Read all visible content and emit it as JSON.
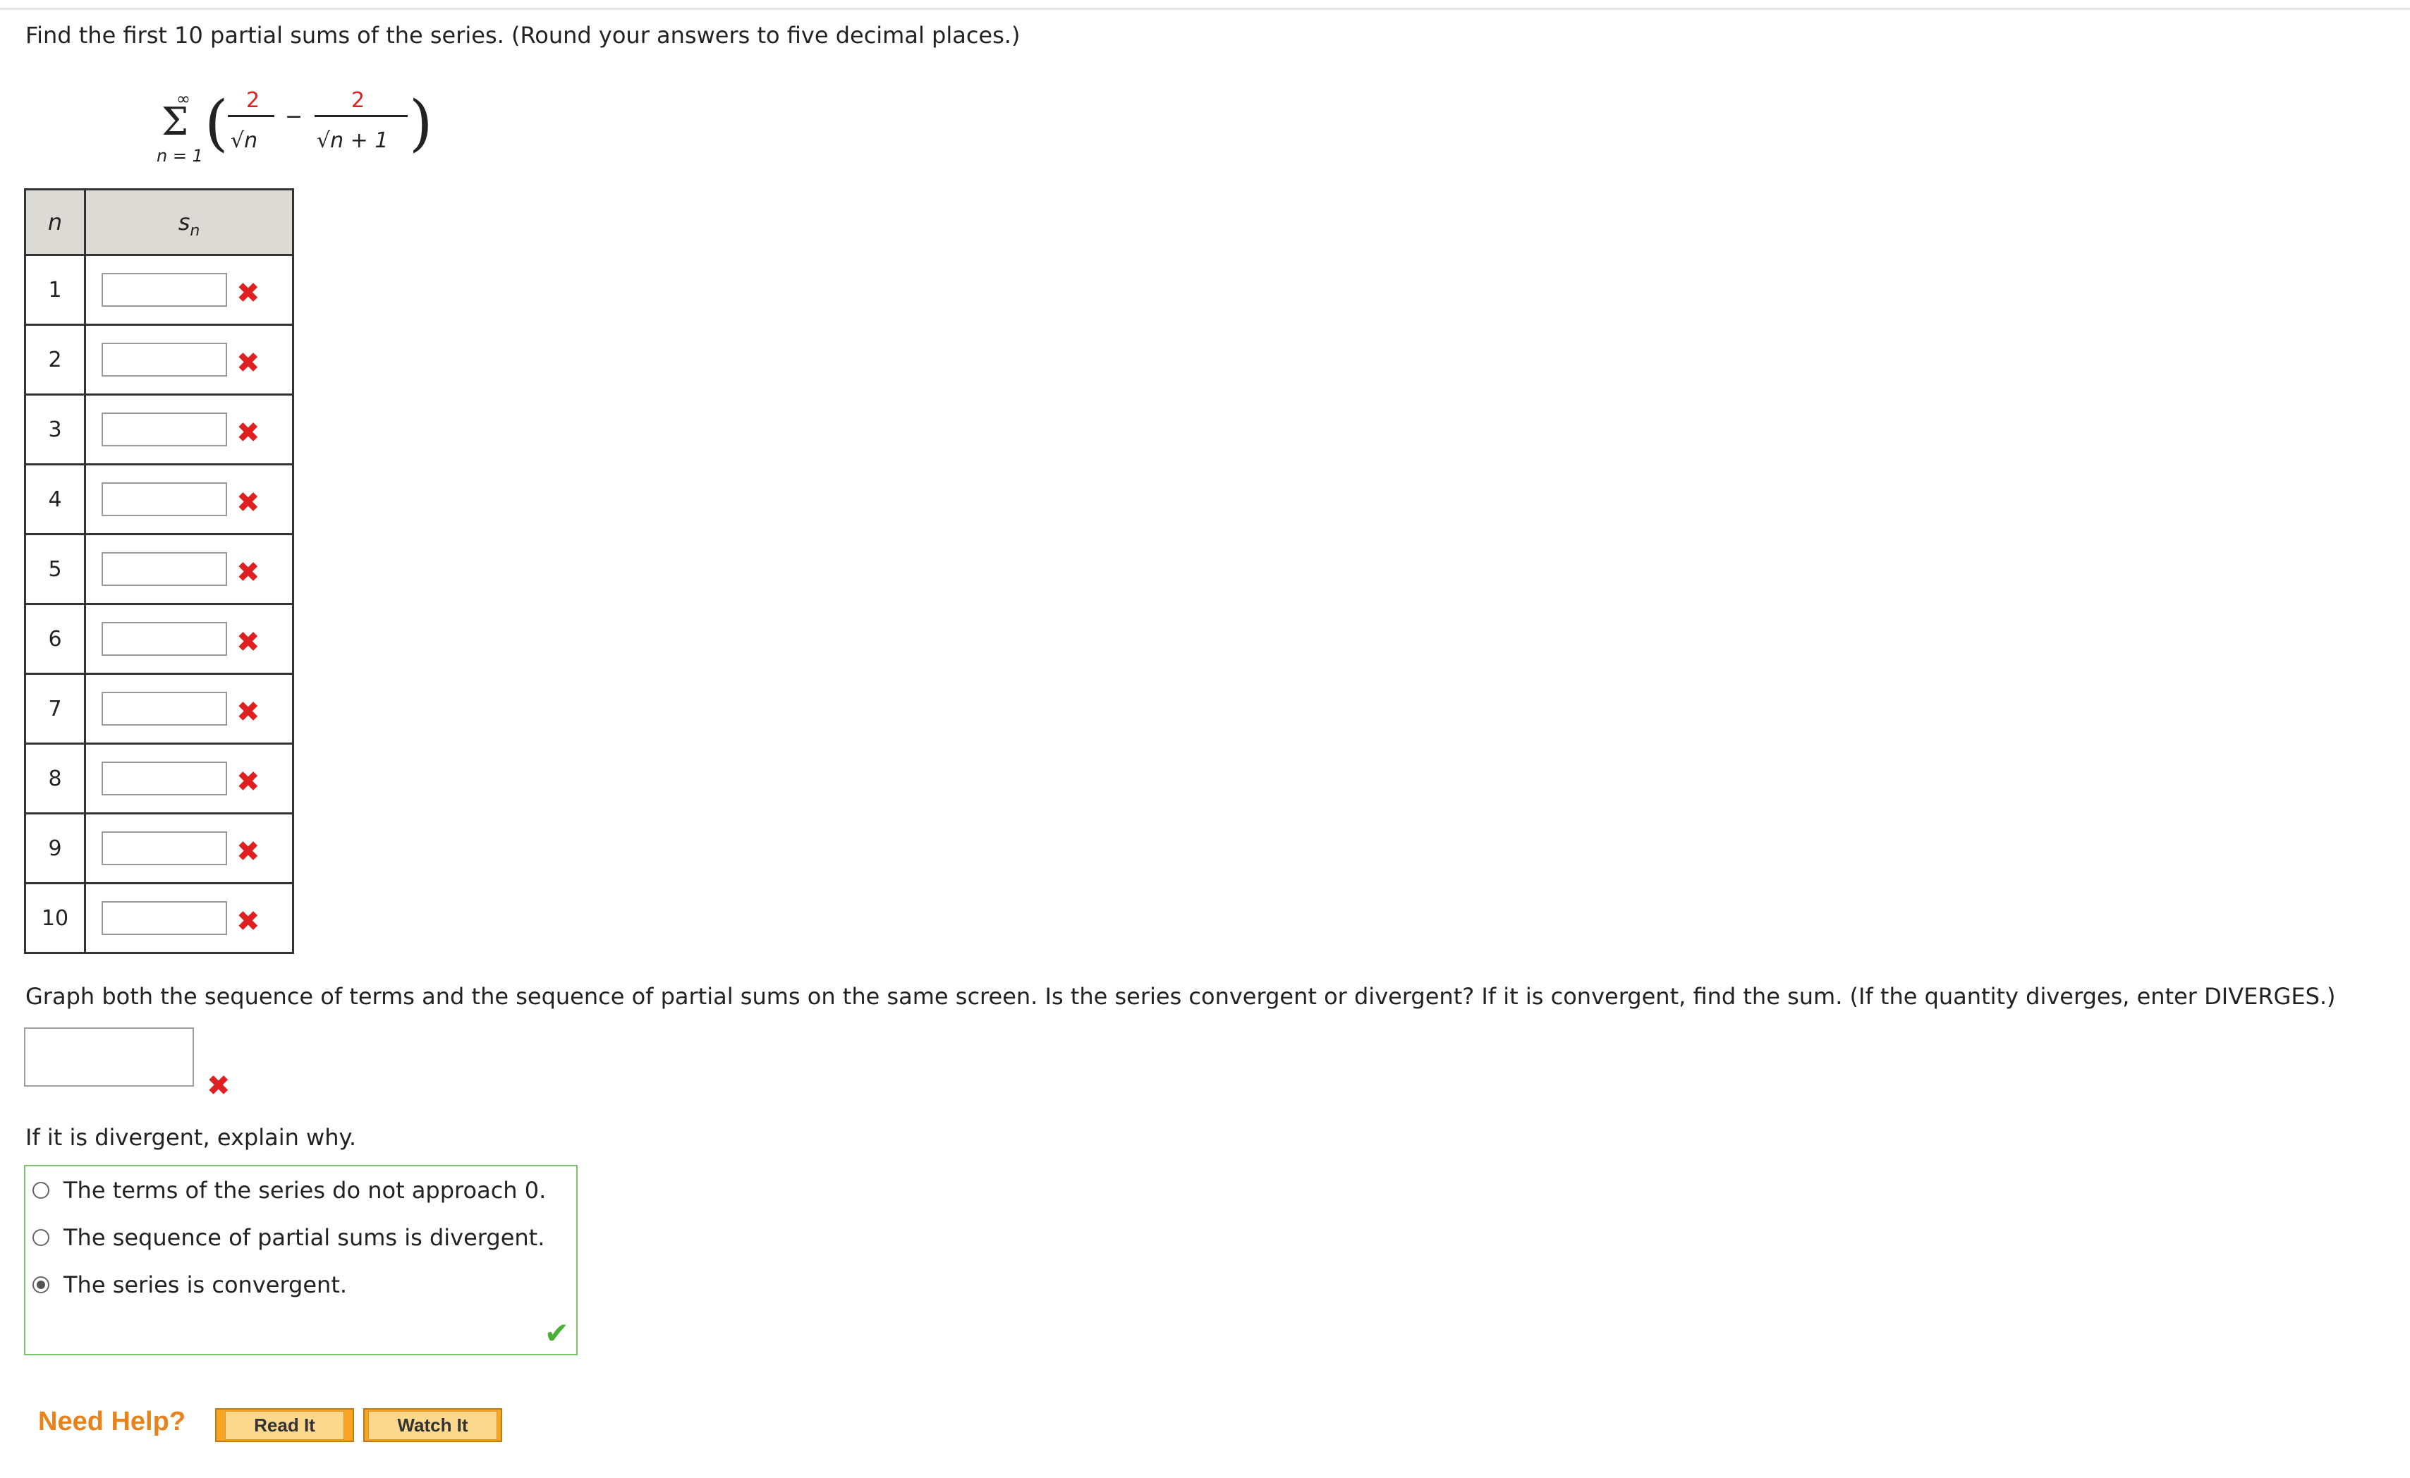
{
  "question": {
    "prompt": "Find the first 10 partial sums of the series. (Round your answers to five decimal places.)",
    "series": {
      "sum_top": "∞",
      "sum_bottom": "n = 1",
      "num1": "2",
      "den1": "√n",
      "minus": "−",
      "num2": "2",
      "den2": "√n + 1"
    },
    "table": {
      "col_n": "n",
      "col_s": "s",
      "col_s_sub": "n",
      "rows": [
        "1",
        "2",
        "3",
        "4",
        "5",
        "6",
        "7",
        "8",
        "9",
        "10"
      ],
      "status": "incorrect"
    },
    "part2_prompt": "Graph both the sequence of terms and the sequence of partial sums on the same screen. Is the series convergent or divergent? If it is convergent, find the sum. (If the quantity diverges, enter DIVERGES.)",
    "part3_prompt": "If it is divergent, explain why.",
    "choices": [
      {
        "label": "The terms of the series do not approach 0.",
        "selected": false
      },
      {
        "label": "The sequence of partial sums is divergent.",
        "selected": false
      },
      {
        "label": "The series is convergent.",
        "selected": true
      }
    ]
  },
  "help": {
    "title": "Need Help?",
    "read_label": "Read It",
    "watch_label": "Watch It"
  },
  "icons": {
    "incorrect": "x-icon",
    "correct": "checkmark-icon"
  },
  "colors": {
    "incorrect": "#e02020",
    "correct": "#4caf3a",
    "help_title": "#e8831c",
    "button": "#f6a623"
  }
}
